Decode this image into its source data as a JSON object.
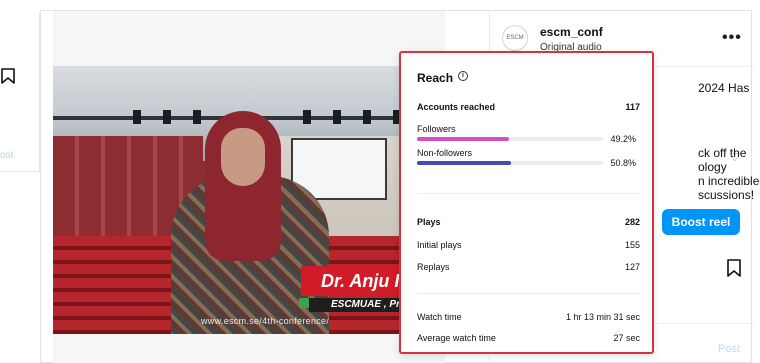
{
  "post": {
    "username": "escm_conf",
    "audio": "Original audio",
    "avatar_text": "ESCM",
    "more_label": "•••",
    "caption_line1": "2024 Has",
    "caption_lines": [
      "ck off the",
      "ology",
      "n incredible",
      "scussions!"
    ],
    "boost_label": "Boost reel",
    "post_label": "Post",
    "ghost_post_label": "ost"
  },
  "video": {
    "lower_third_name": "Dr. Anju I",
    "lower_third_sub": "ESCMUAE , Presi",
    "url": "www.escm.se/4th-conference/"
  },
  "reach": {
    "title": "Reach",
    "accounts_reached_label": "Accounts reached",
    "accounts_reached_value": "117",
    "followers_label": "Followers",
    "followers_pct": "49.2%",
    "followers_share": 0.492,
    "followers_color": "#d14fc5",
    "nonfollowers_label": "Non-followers",
    "nonfollowers_pct": "50.8%",
    "nonfollowers_share": 0.508,
    "nonfollowers_color": "#4b48b3",
    "plays_label": "Plays",
    "plays_value": "282",
    "initial_plays_label": "Initial plays",
    "initial_plays_value": "155",
    "replays_label": "Replays",
    "replays_value": "127",
    "watch_time_label": "Watch time",
    "watch_time_value": "1 hr 13 min 31 sec",
    "avg_watch_label": "Average watch time",
    "avg_watch_value": "27 sec",
    "highlight_color": "#d9323a"
  }
}
